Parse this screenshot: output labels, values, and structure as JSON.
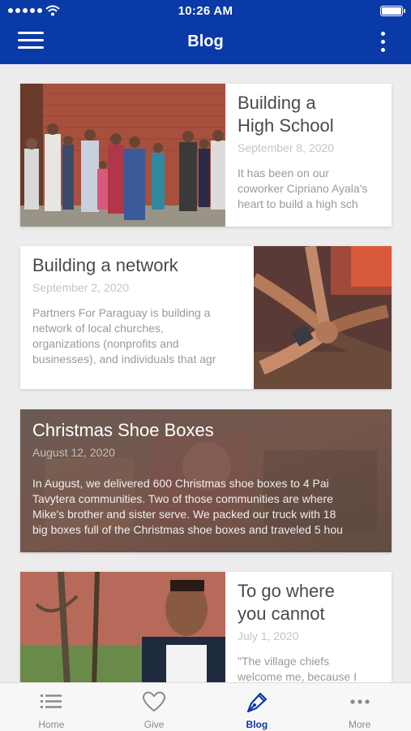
{
  "status_bar": {
    "time": "10:26 AM"
  },
  "header": {
    "title": "Blog",
    "menu_icon": "hamburger-menu-icon",
    "more_icon": "vertical-dots-icon"
  },
  "posts": [
    {
      "title": "Building a\nHigh School",
      "date": "September 8, 2020",
      "excerpt": "It has been on our\ncoworker Cipriano Ayala's\nheart to build a high sch",
      "image": "group-photo-brick-wall"
    },
    {
      "title": "Building a network",
      "date": "September 2, 2020",
      "excerpt": "Partners For Paraguay is building a\nnetwork of local churches,\norganizations (nonprofits and\nbusinesses), and individuals that agr",
      "image": "hands-together-photo"
    },
    {
      "title": "Christmas Shoe Boxes",
      "date": "August 12, 2020",
      "excerpt": "In August, we delivered 600 Christmas shoe boxes to 4 Pai\nTavytera communities. Two of those communities are where\nMike's brother and sister serve. We packed our truck with 18\nbig boxes full of the Christmas shoe boxes and traveled 5 hou",
      "image": "shoe-boxes-background-photo"
    },
    {
      "title": "To go where\nyou cannot",
      "date": "July 1, 2020",
      "excerpt": "\"The village chiefs\nwelcome me, because I",
      "image": "village-man-portrait"
    }
  ],
  "tab_bar": {
    "active": "Blog",
    "items": [
      {
        "label": "Home",
        "icon": "list-icon"
      },
      {
        "label": "Give",
        "icon": "heart-icon"
      },
      {
        "label": "Blog",
        "icon": "pen-icon"
      },
      {
        "label": "More",
        "icon": "horizontal-dots-icon"
      }
    ]
  },
  "colors": {
    "primary": "#0a3aa8",
    "background": "#ececec",
    "tab_inactive": "#8a8a8a"
  }
}
